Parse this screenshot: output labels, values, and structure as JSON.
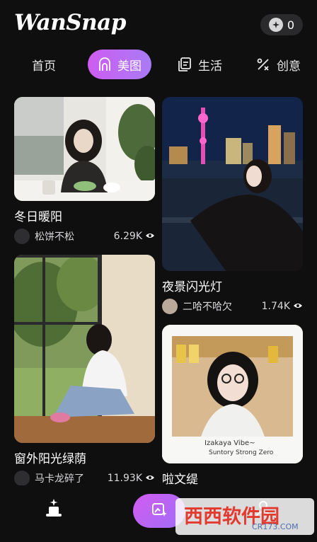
{
  "app": {
    "logo": "WanSnap"
  },
  "header": {
    "coins": "0",
    "coin_icon": "plus-coin-icon"
  },
  "tabs": [
    {
      "label": "首页",
      "icon": "",
      "active": false
    },
    {
      "label": "美图",
      "icon": "beauty-icon",
      "active": true
    },
    {
      "label": "生活",
      "icon": "life-icon",
      "active": false
    },
    {
      "label": "创意",
      "icon": "creative-icon",
      "active": false
    }
  ],
  "feed": [
    {
      "title": "冬日暖阳",
      "author": "松饼不松",
      "views": "6.29K",
      "photo": "girl-in-cafe-by-window"
    },
    {
      "title": "夜景闪光灯",
      "author": "二哈不哈欠",
      "views": "1.74K",
      "photo": "woman-at-night-skyline"
    },
    {
      "title": "窗外阳光绿荫",
      "author": "马卡龙碎了",
      "views": "11.93K",
      "photo": "girl-sitting-by-sunny-window"
    },
    {
      "title": "啦文缇",
      "author": "",
      "views": "",
      "photo": "polaroid-girl-glasses"
    }
  ],
  "polaroid": {
    "caption_line1": "Izakaya Vibe~",
    "caption_line2": "Suntory Strong Zero"
  },
  "bottom_nav": {
    "items": [
      "magic-hat-icon",
      "create-image-icon",
      "profile-icon"
    ]
  },
  "watermark": {
    "main": "西西软件园",
    "sub": "CR173.COM"
  },
  "colors": {
    "accent_start": "#ce5cf0",
    "accent_end": "#a97bf7",
    "background": "#0f0f10"
  }
}
